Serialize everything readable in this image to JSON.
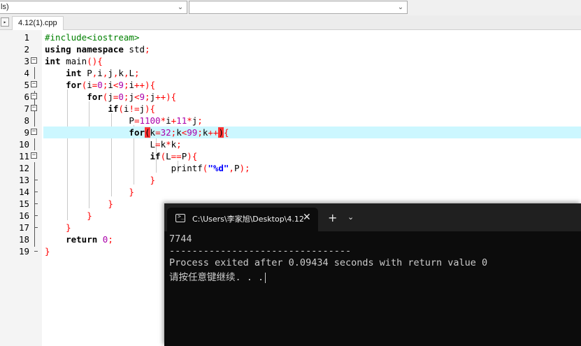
{
  "toolbar": {
    "combo_left_text": "ls)"
  },
  "tabs": {
    "active_label": "4.12(1).cpp"
  },
  "editor": {
    "line_numbers": [
      "1",
      "2",
      "3",
      "4",
      "5",
      "6",
      "7",
      "8",
      "9",
      "10",
      "11",
      "12",
      "13",
      "14",
      "15",
      "16",
      "17",
      "18",
      "19"
    ],
    "highlighted_line": 9
  },
  "terminal": {
    "tab_title": "C:\\Users\\李家旭\\Desktop\\4.12",
    "output": [
      "7744",
      "--------------------------------",
      "Process exited after 0.09434 seconds with return value 0",
      "请按任意键继续. . ."
    ]
  },
  "colors": {
    "keyword": "#000000",
    "preprocessor": "#008000",
    "symbol": "#ff0000",
    "number": "#aa00aa",
    "string": "#0000ff",
    "current_line": "#ccf7ff",
    "bracket_match": "#ff3333",
    "terminal_bg": "#0c0c0c"
  },
  "icons": {
    "tab_nav": "tab-nav-icon",
    "terminal": "terminal-app-icon",
    "close": "close-icon",
    "new_tab": "plus-icon",
    "dropdown": "chevron-down-icon"
  }
}
